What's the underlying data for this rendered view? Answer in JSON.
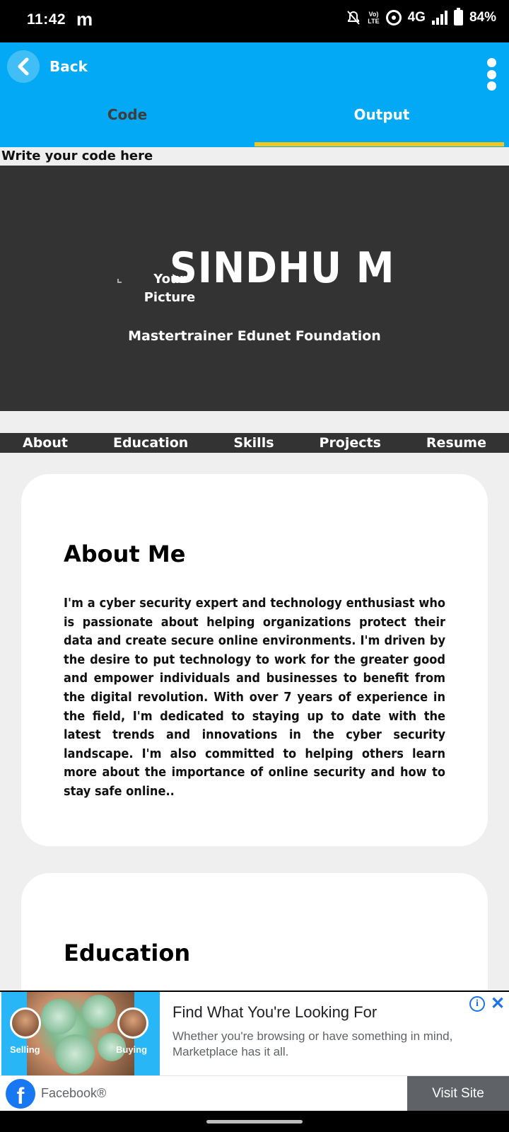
{
  "status_bar": {
    "time": "11:42",
    "notification_letter": "m",
    "volte_label": "Vo\nLTE",
    "network": "4G",
    "battery": "84%"
  },
  "app_bar": {
    "back_label": "Back",
    "tabs": [
      {
        "label": "Code",
        "active": false
      },
      {
        "label": "Output",
        "active": true
      }
    ],
    "accent_color": "#03a9f4",
    "indicator_color": "#f5c518"
  },
  "page": {
    "write_here": "Write your code here",
    "hero": {
      "picture_alt": "Your Picture",
      "name": "SINDHU M",
      "subtitle": "Mastertrainer Edunet Foundation"
    },
    "nav": [
      "About",
      "Education",
      "Skills",
      "Projects",
      "Resume"
    ],
    "about": {
      "title": "About Me",
      "text": "I'm a cyber security expert and technology enthusiast who is passionate about helping organizations protect their data and create secure online environments. I'm driven by the desire to put technology to work for the greater good and empower individuals and businesses to benefit from the digital revolution. With over 7 years of experience in the field, I'm dedicated to staying up to date with the latest trends and innovations in the cyber security landscape. I'm also committed to helping others learn more about the importance of online security and how to stay safe online.."
    },
    "education": {
      "title": "Education"
    }
  },
  "ad": {
    "tag_left": "Selling",
    "tag_right": "Buying",
    "title": "Find What You're Looking For",
    "description": "Whether you're browsing or have something in mind, Marketplace has it all.",
    "brand": "Facebook®",
    "cta": "Visit Site",
    "info_glyph": "i",
    "close_glyph": "✕",
    "logo_glyph": "f"
  }
}
